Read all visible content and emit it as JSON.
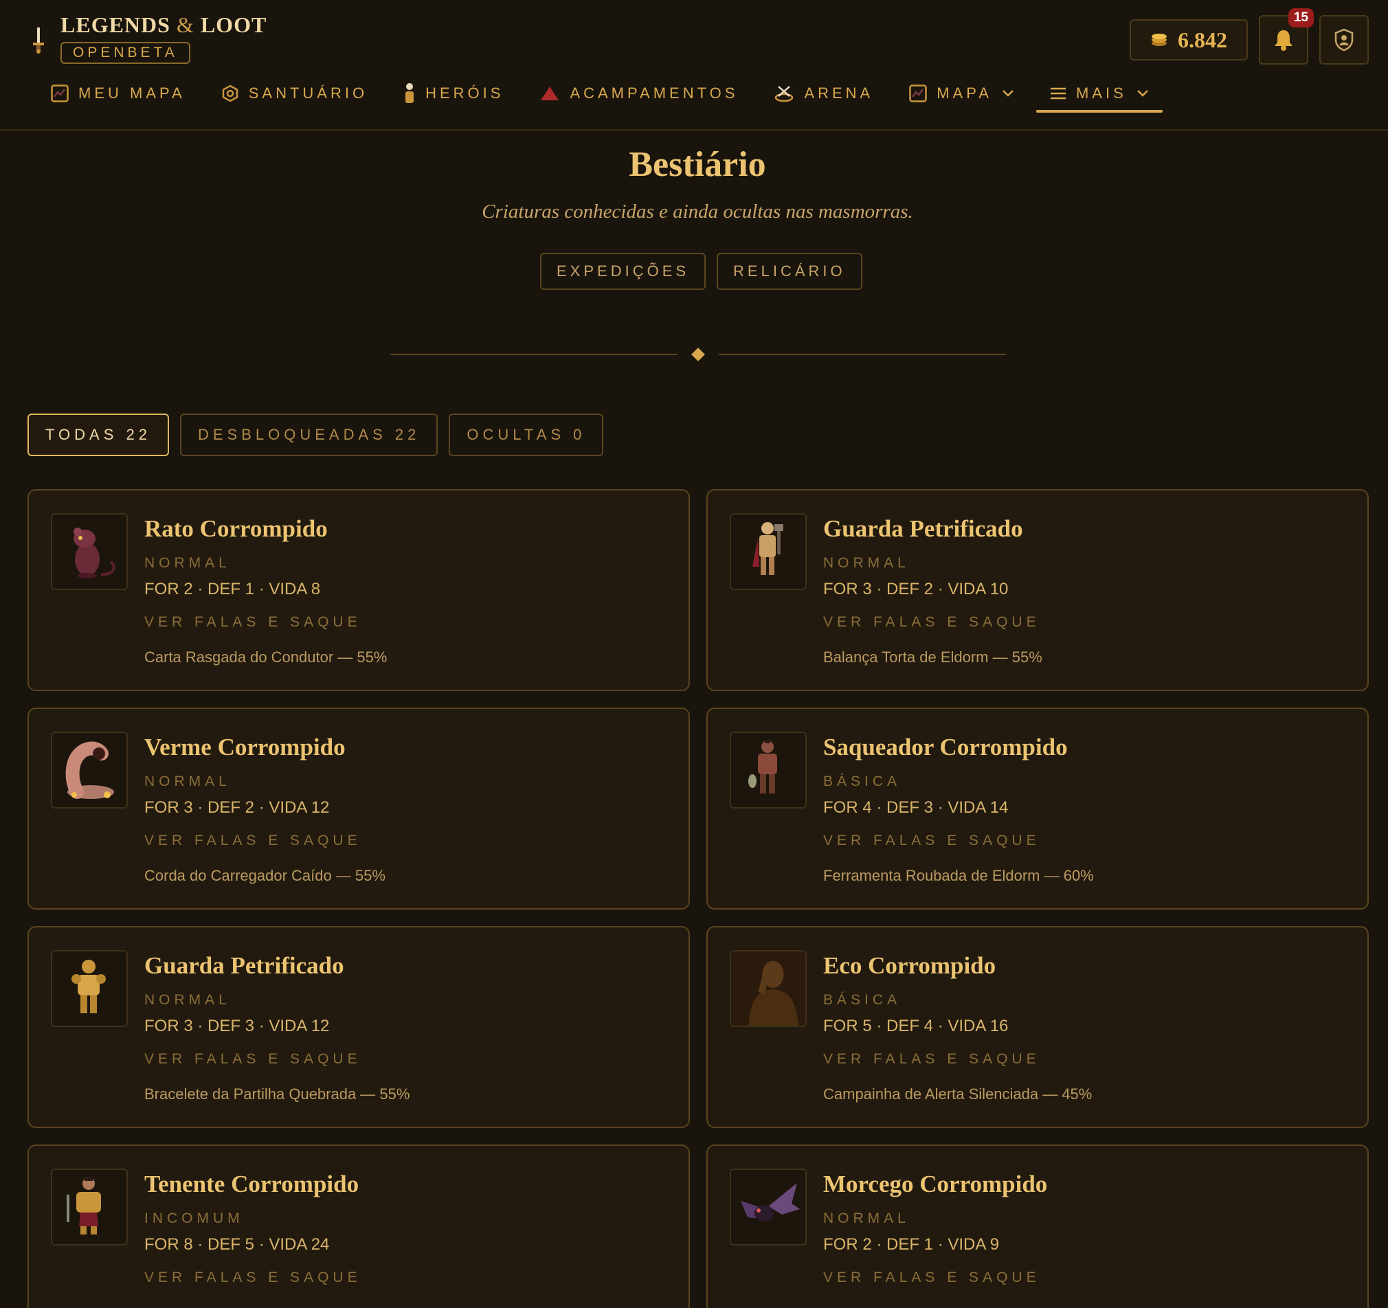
{
  "brand": {
    "title_a": "LEGENDS",
    "amp": "&",
    "title_b": "LOOT",
    "badge": "OPENBETA"
  },
  "header": {
    "gold": "6.842",
    "notifications": "15"
  },
  "nav": [
    {
      "label": "MEU MAPA",
      "icon": "map-icon"
    },
    {
      "label": "SANTUÁRIO",
      "icon": "hexagon-icon"
    },
    {
      "label": "HERÓIS",
      "icon": "hero-icon"
    },
    {
      "label": "ACAMPAMENTOS",
      "icon": "tent-icon"
    },
    {
      "label": "ARENA",
      "icon": "arena-icon"
    },
    {
      "label": "MAPA",
      "icon": "map-icon"
    },
    {
      "label": "MAIS",
      "icon": "menu-icon"
    }
  ],
  "page": {
    "title": "Bestiário",
    "subtitle": "Criaturas conhecidas e ainda ocultas nas masmorras.",
    "links": [
      "EXPEDIÇÕES",
      "RELICÁRIO"
    ]
  },
  "filters": [
    {
      "label": "TODAS 22",
      "active": true
    },
    {
      "label": "DESBLOQUEADAS 22",
      "active": false
    },
    {
      "label": "OCULTAS 0",
      "active": false
    }
  ],
  "action_label": "VER FALAS E SAQUE",
  "creatures": [
    {
      "name": "Rato Corrompido",
      "rarity": "NORMAL",
      "stats": "FOR 2 · DEF 1 · VIDA 8",
      "loot": "Carta Rasgada do Condutor — 55%",
      "art": "rat",
      "color": "#6b2a38"
    },
    {
      "name": "Guarda Petrificado",
      "rarity": "NORMAL",
      "stats": "FOR 3 · DEF 2 · VIDA 10",
      "loot": "Balança Torta de Eldorm — 55%",
      "art": "knight",
      "color": "#b8894a"
    },
    {
      "name": "Verme Corrompido",
      "rarity": "NORMAL",
      "stats": "FOR 3 · DEF 2 · VIDA 12",
      "loot": "Corda do Carregador Caído — 55%",
      "art": "worm",
      "color": "#c98a7a"
    },
    {
      "name": "Saqueador Corrompido",
      "rarity": "BÁSICA",
      "stats": "FOR 4 · DEF 3 · VIDA 14",
      "loot": "Ferramenta Roubada de Eldorm — 60%",
      "art": "bandit",
      "color": "#8a4a3a"
    },
    {
      "name": "Guarda Petrificado",
      "rarity": "NORMAL",
      "stats": "FOR 3 · DEF 3 · VIDA 12",
      "loot": "Bracelete da Partilha Quebrada — 55%",
      "art": "armor",
      "color": "#c9963c"
    },
    {
      "name": "Eco Corrompido",
      "rarity": "BÁSICA",
      "stats": "FOR 5 · DEF 4 · VIDA 16",
      "loot": "Campainha de Alerta Silenciada — 45%",
      "art": "shadow",
      "color": "#3a2610"
    },
    {
      "name": "Tenente Corrompido",
      "rarity": "INCOMUM",
      "stats": "FOR 8 · DEF 5 · VIDA 24",
      "loot": "",
      "art": "lieutenant",
      "color": "#c9963c"
    },
    {
      "name": "Morcego Corrompido",
      "rarity": "NORMAL",
      "stats": "FOR 2 · DEF 1 · VIDA 9",
      "loot": "",
      "art": "bat",
      "color": "#6a4a7a"
    }
  ]
}
